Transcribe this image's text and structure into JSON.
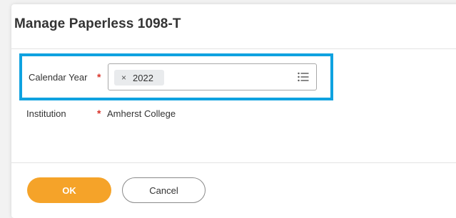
{
  "dialog": {
    "title": "Manage Paperless 1098-T"
  },
  "fields": {
    "calendar_year": {
      "label": "Calendar Year",
      "required_marker": "*",
      "selected": [
        {
          "remove": "×",
          "value": "2022"
        }
      ]
    },
    "institution": {
      "label": "Institution",
      "required_marker": "*",
      "value": "Amherst College"
    }
  },
  "buttons": {
    "ok": "OK",
    "cancel": "Cancel"
  },
  "colors": {
    "highlight_border": "#0fa2e0",
    "ok_button": "#f5a329",
    "required": "#d9342b"
  },
  "icons": {
    "prompt": "list-icon"
  }
}
